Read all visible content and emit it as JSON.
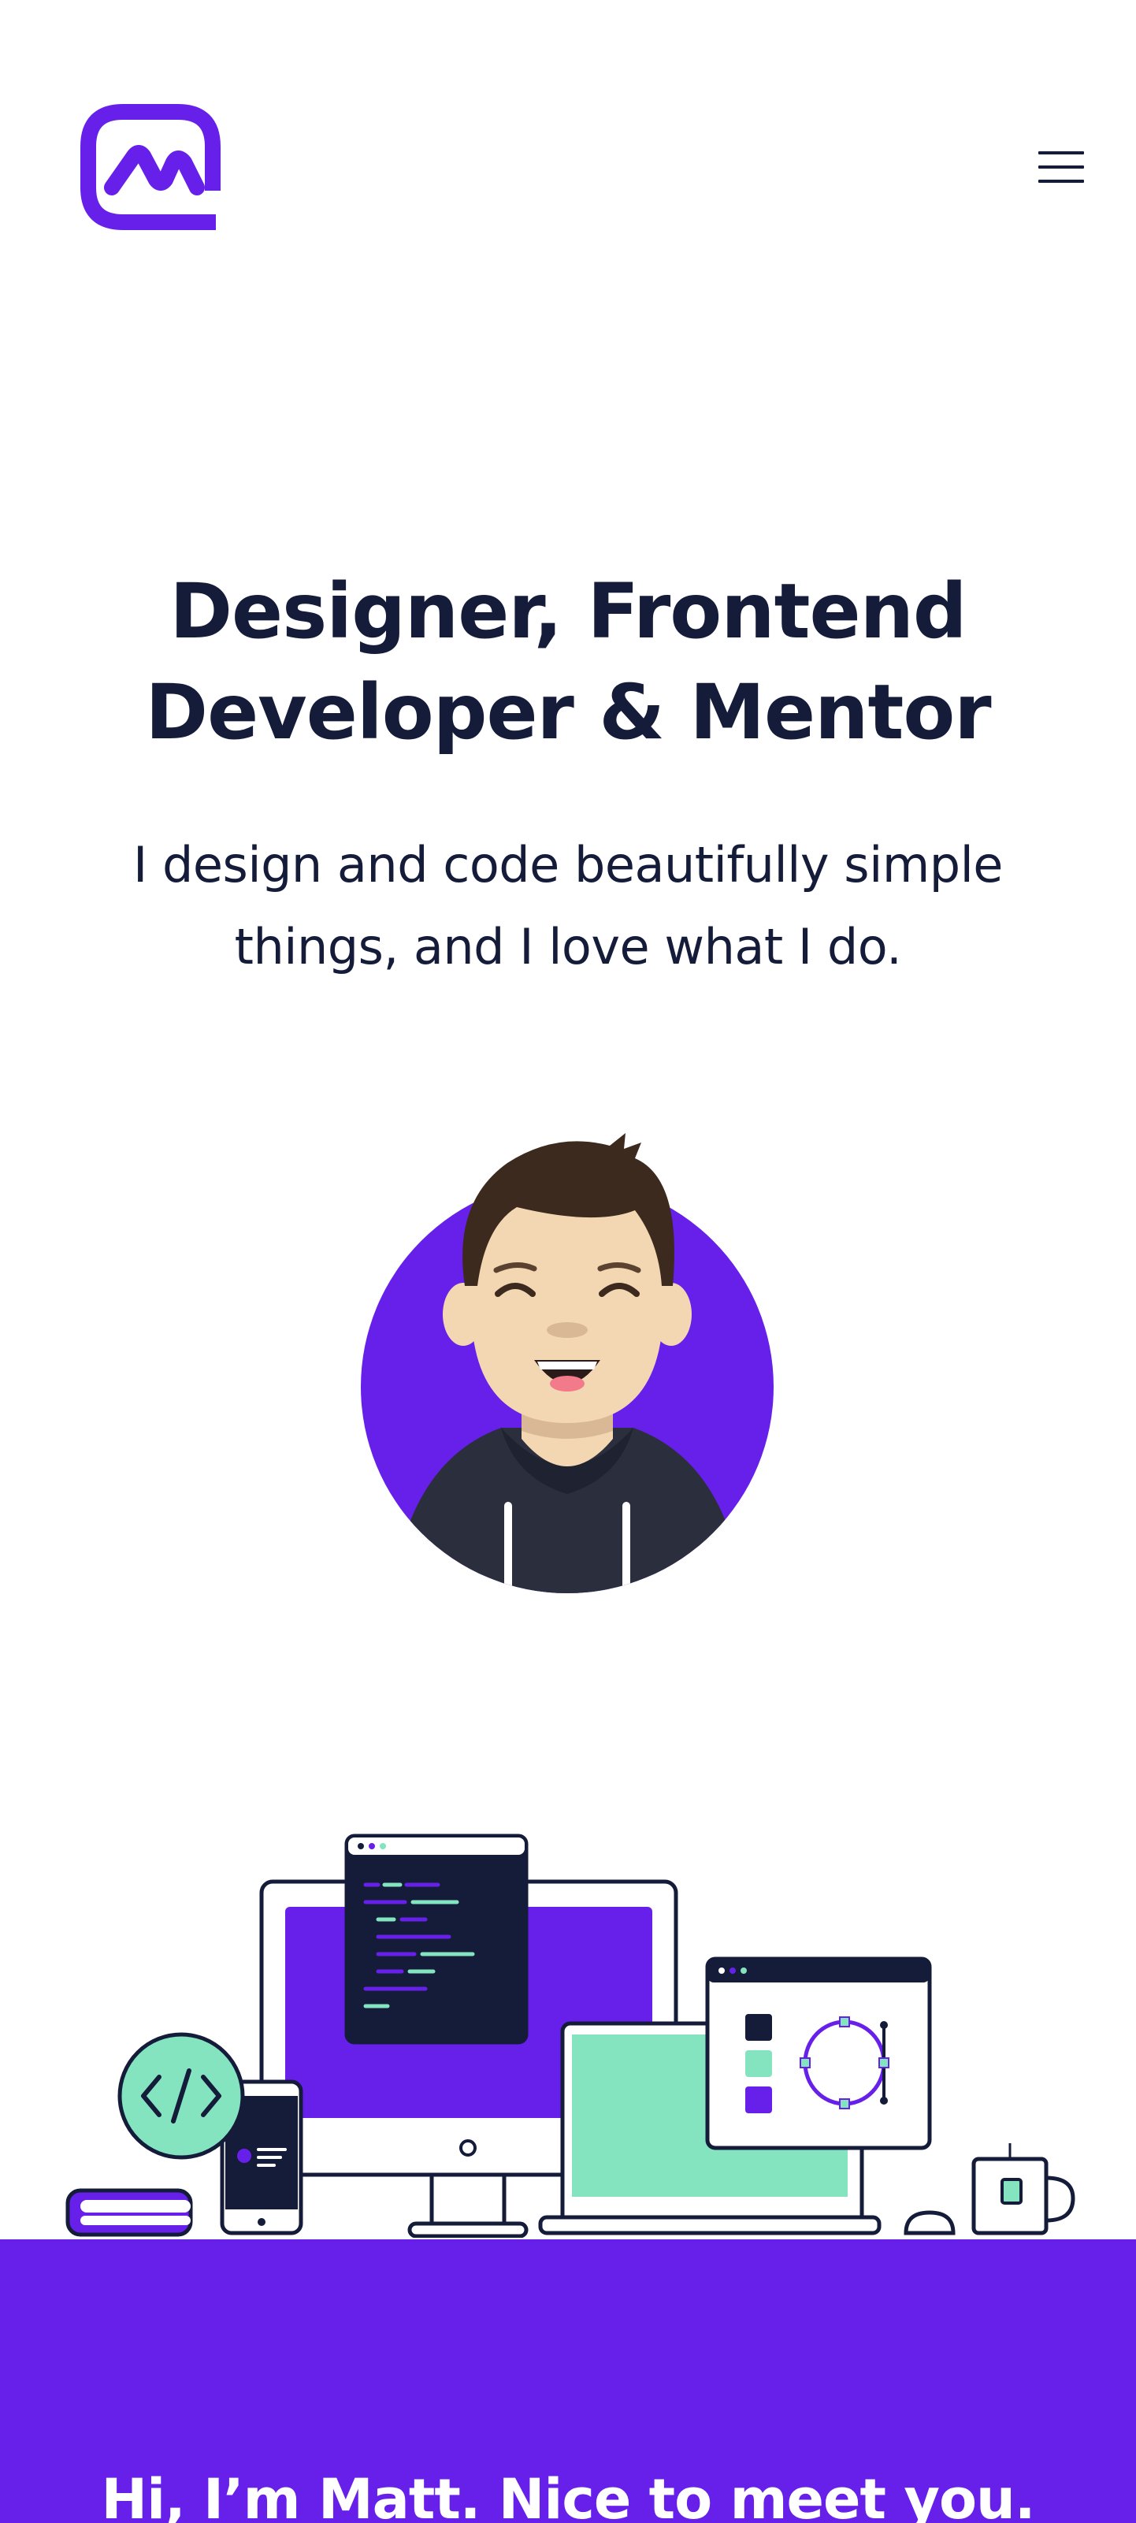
{
  "header": {
    "logo_icon": "matt-logo-icon",
    "menu_icon": "hamburger-menu-icon",
    "brand_color": "#6720ea"
  },
  "hero": {
    "title_line1": "Designer, Frontend",
    "title_line2": "Developer & Mentor",
    "subtitle_line1": "I design and code beautifully simple",
    "subtitle_line2": "things, and I love what I do.",
    "avatar_icon": "avatar-illustration",
    "workspace_icon": "workspace-illustration"
  },
  "intro": {
    "title": "Hi, I’m Matt. Nice to meet you.",
    "background": "#6720ea"
  },
  "colors": {
    "text": "#141c3a",
    "accent": "#6720ea",
    "mint": "#84e4c0"
  }
}
